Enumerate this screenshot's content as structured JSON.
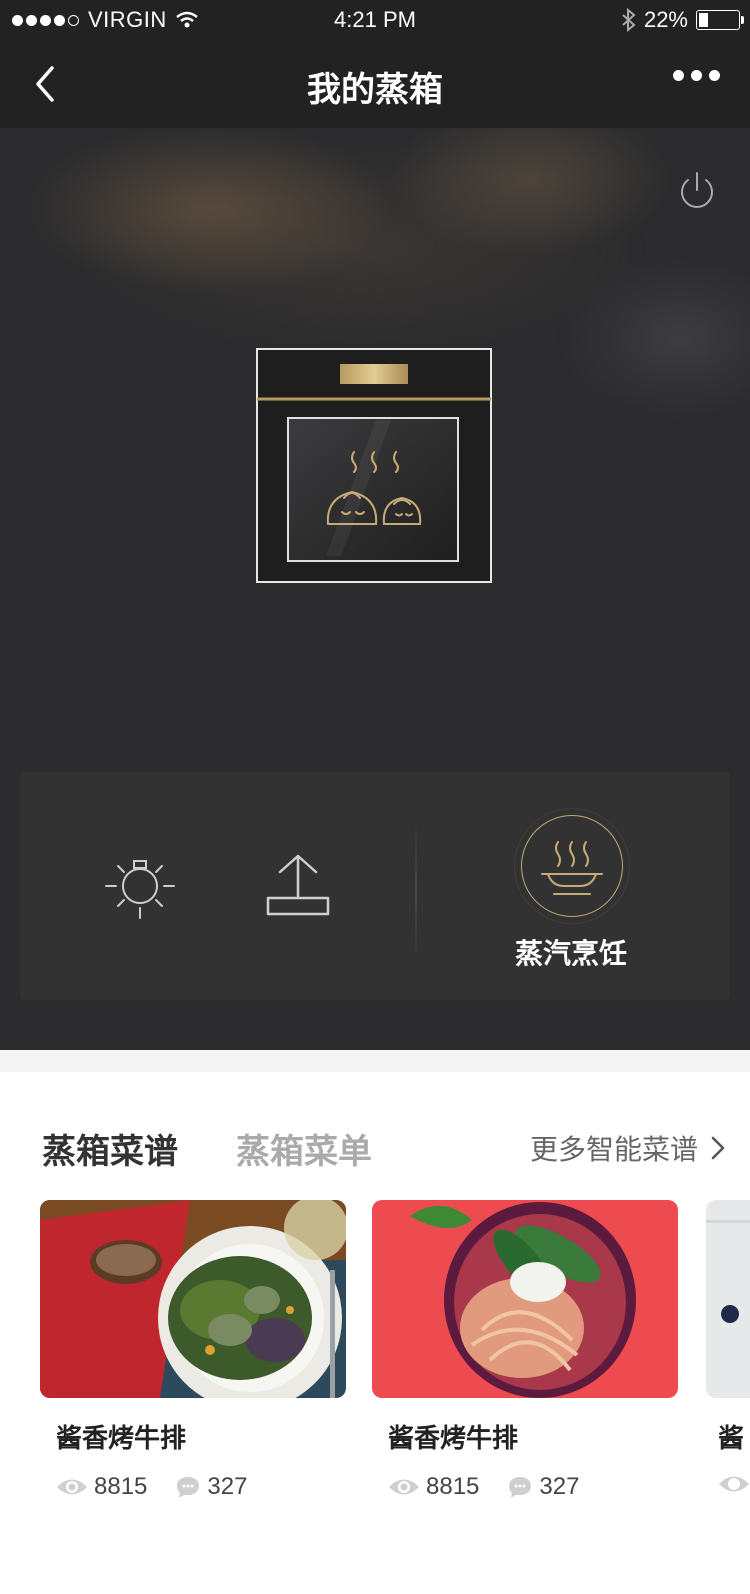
{
  "status_bar": {
    "carrier": "VIRGIN",
    "time": "4:21 PM",
    "battery": "22%"
  },
  "nav": {
    "title": "我的蒸箱"
  },
  "controls": {
    "mode_label": "蒸汽烹饪"
  },
  "tabs": {
    "active": "蒸箱菜谱",
    "inactive": "蒸箱菜单",
    "more": "更多智能菜谱"
  },
  "recipes": [
    {
      "title": "酱香烤牛排",
      "views": "8815",
      "comments": "327"
    },
    {
      "title": "酱香烤牛排",
      "views": "8815",
      "comments": "327"
    },
    {
      "title": "酱"
    }
  ],
  "colors": {
    "gold": "#c5ab74",
    "dark_bg": "#222223"
  }
}
